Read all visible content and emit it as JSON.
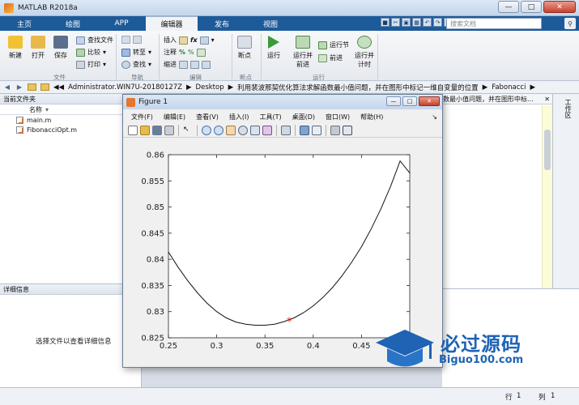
{
  "window": {
    "title": "MATLAB R2018a"
  },
  "tabs": [
    "主页",
    "绘图",
    "APP",
    "编辑器",
    "发布",
    "视图"
  ],
  "active_tab": "编辑器",
  "search_placeholder": "搜索文档",
  "ribbon": {
    "file": {
      "new": "新建",
      "open": "打开",
      "save": "保存",
      "find_files": "查找文件",
      "compare": "比较",
      "print": "打印",
      "group": "文件"
    },
    "navigate": {
      "goto": "转至",
      "find": "查找",
      "group": "导航"
    },
    "edit": {
      "insert": "插入",
      "comment": "注释",
      "indent": "缩进",
      "fx": "fx",
      "group": "编辑"
    },
    "breakpoints": {
      "breakpoints": "断点",
      "group": "断点"
    },
    "run": {
      "run": "运行",
      "run_advance": "运行并\n前进",
      "run_section": "运行节",
      "advance": "前进",
      "run_time": "运行并\n计时",
      "group": "运行"
    }
  },
  "address": {
    "path": [
      "Administrator.WIN7U-20180127Z",
      "Desktop",
      "利用裴波那契优化算法求解函数最小值问题，并在图形中标记一维自变量的位置",
      "Fabonacci"
    ]
  },
  "current_folder": {
    "title": "当前文件夹",
    "column": "名称",
    "files": [
      "main.m",
      "FibonacciOpt.m"
    ]
  },
  "details": {
    "title": "详细信息",
    "message": "选择文件以查看详细信息"
  },
  "editor_tab": "数最小值问题，并在图形中标...",
  "workspace_label": "工作区",
  "status": {
    "row_label": "行",
    "row": "1",
    "col_label": "列",
    "col": "1"
  },
  "figure": {
    "title": "Figure 1",
    "menu": [
      "文件(F)",
      "编辑(E)",
      "查看(V)",
      "插入(I)",
      "工具(T)",
      "桌面(D)",
      "窗口(W)",
      "帮助(H)"
    ]
  },
  "watermark": {
    "text": "必过源码",
    "url": "Biguo100.com"
  },
  "chart_data": {
    "type": "line",
    "xlim": [
      0.25,
      0.5
    ],
    "ylim": [
      0.825,
      0.86
    ],
    "xticks": [
      0.25,
      0.3,
      0.35,
      0.4,
      0.45
    ],
    "xtick_labels": [
      "0.25",
      "0.3",
      "0.35",
      "0.4",
      "0.45"
    ],
    "yticks": [
      0.825,
      0.83,
      0.835,
      0.84,
      0.845,
      0.85,
      0.855,
      0.86
    ],
    "ytick_labels": [
      "0.825",
      "0.83",
      "0.835",
      "0.84",
      "0.845",
      "0.85",
      "0.855",
      "0.86"
    ],
    "grid": false,
    "series": [
      {
        "values": [
          [
            0.25,
            0.8414
          ],
          [
            0.26,
            0.8385
          ],
          [
            0.27,
            0.8359
          ],
          [
            0.28,
            0.8336
          ],
          [
            0.29,
            0.8316
          ],
          [
            0.3,
            0.83
          ],
          [
            0.31,
            0.8288
          ],
          [
            0.32,
            0.828
          ],
          [
            0.33,
            0.8276
          ],
          [
            0.34,
            0.8274
          ],
          [
            0.35,
            0.8274
          ],
          [
            0.36,
            0.8276
          ],
          [
            0.37,
            0.8281
          ],
          [
            0.38,
            0.8288
          ],
          [
            0.39,
            0.8298
          ],
          [
            0.4,
            0.8311
          ],
          [
            0.41,
            0.8327
          ],
          [
            0.42,
            0.8346
          ],
          [
            0.43,
            0.8369
          ],
          [
            0.44,
            0.8395
          ],
          [
            0.45,
            0.8424
          ],
          [
            0.46,
            0.8458
          ],
          [
            0.47,
            0.8496
          ],
          [
            0.48,
            0.8539
          ],
          [
            0.49,
            0.8588
          ],
          [
            0.5,
            0.8565
          ]
        ]
      }
    ],
    "marker": {
      "x": 0.375,
      "y": 0.8282,
      "symbol": "*",
      "color": "#e01010"
    },
    "line_color": "#111111"
  }
}
